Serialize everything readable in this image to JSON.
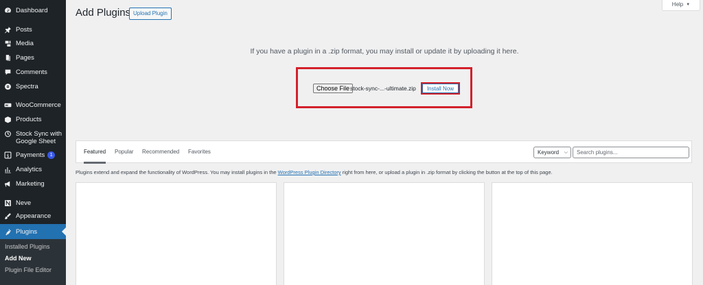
{
  "sidebar": {
    "items": [
      {
        "label": "Dashboard",
        "icon": "dashboard-icon"
      },
      {
        "label": "Posts",
        "icon": "pin-icon"
      },
      {
        "label": "Media",
        "icon": "media-icon"
      },
      {
        "label": "Pages",
        "icon": "pages-icon"
      },
      {
        "label": "Comments",
        "icon": "comments-icon"
      },
      {
        "label": "Spectra",
        "icon": "spectra-icon"
      },
      {
        "label": "WooCommerce",
        "icon": "woo-icon"
      },
      {
        "label": "Products",
        "icon": "products-icon"
      },
      {
        "label": "Stock Sync with Google Sheet",
        "icon": "stock-sync-icon"
      },
      {
        "label": "Payments",
        "icon": "payments-icon",
        "badge": "1"
      },
      {
        "label": "Analytics",
        "icon": "analytics-icon"
      },
      {
        "label": "Marketing",
        "icon": "megaphone-icon"
      },
      {
        "label": "Neve",
        "icon": "neve-icon"
      },
      {
        "label": "Appearance",
        "icon": "brush-icon"
      },
      {
        "label": "Plugins",
        "icon": "plugin-icon"
      }
    ],
    "submenu": [
      "Installed Plugins",
      "Add New",
      "Plugin File Editor"
    ]
  },
  "header": {
    "title": "Add Plugins",
    "upload_label": "Upload Plugin",
    "help_label": "Help"
  },
  "upload": {
    "instruction": "If you have a plugin in a .zip format, you may install or update it by uploading it here.",
    "choose_label": "Choose File",
    "file_name": "stock-sync-...-ultimate.zip",
    "install_label": "Install Now"
  },
  "filter": {
    "tabs": [
      "Featured",
      "Popular",
      "Recommended",
      "Favorites"
    ],
    "keyword_label": "Keyword",
    "search_placeholder": "Search plugins..."
  },
  "description": {
    "before": "Plugins extend and expand the functionality of WordPress. You may install plugins in the ",
    "link": "WordPress Plugin Directory",
    "after": " right from here, or upload a plugin in .zip format by clicking the button at the top of this page."
  },
  "colors": {
    "sidebar_bg": "#1d2327",
    "active_bg": "#2271b1",
    "highlight_red": "#d3202a",
    "badge_blue": "#3858e9"
  }
}
